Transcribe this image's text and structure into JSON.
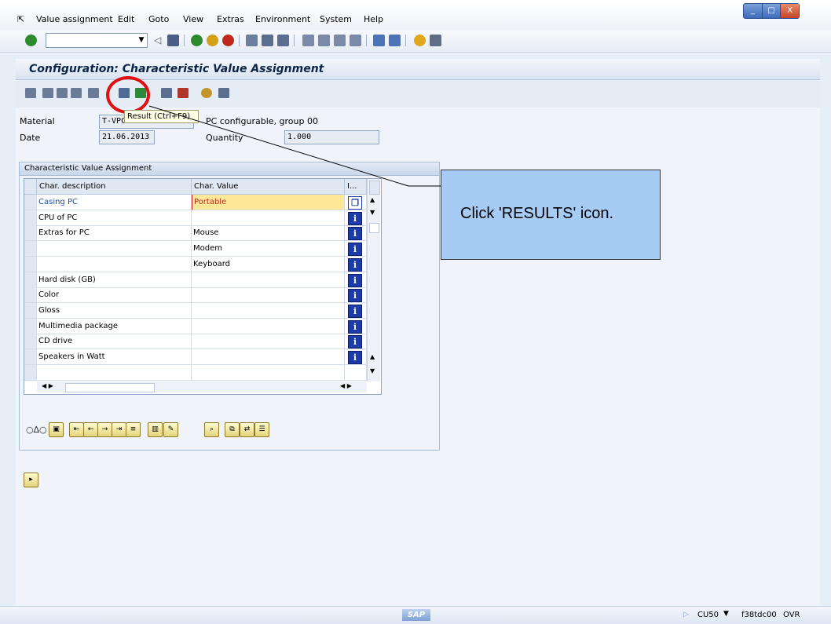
{
  "menubar": {
    "items": [
      "Value assignment",
      "Edit",
      "Goto",
      "View",
      "Extras",
      "Environment",
      "System",
      "Help"
    ]
  },
  "window_controls": [
    "_",
    "□",
    "X"
  ],
  "title": "Configuration: Characteristic Value Assignment",
  "header_fields": {
    "material_label": "Material",
    "material_value": "T-VPC",
    "material_desc": "PC configurable, group 00",
    "date_label": "Date",
    "date_value": "21.06.2013",
    "quantity_label": "Quantity",
    "quantity_value": "1.000"
  },
  "tooltip": "Result    (Ctrl+F9)",
  "group_title": "Characteristic Value Assignment",
  "table": {
    "columns": [
      "Char. description",
      "Char. Value",
      "I..."
    ],
    "rows": [
      {
        "desc": "Casing PC",
        "value": "Portable",
        "info": "copy"
      },
      {
        "desc": "CPU of PC",
        "value": "",
        "info": "i"
      },
      {
        "desc": "Extras for PC",
        "value": "Mouse",
        "info": "i"
      },
      {
        "desc": "",
        "value": "Modem",
        "info": "i"
      },
      {
        "desc": "",
        "value": "Keyboard",
        "info": "i"
      },
      {
        "desc": "Hard disk (GB)",
        "value": "",
        "info": "i"
      },
      {
        "desc": "Color",
        "value": "",
        "info": "i"
      },
      {
        "desc": "Gloss",
        "value": "",
        "info": "i"
      },
      {
        "desc": " Multimedia package",
        "value": "",
        "info": "i"
      },
      {
        "desc": "CD drive",
        "value": "",
        "info": "i"
      },
      {
        "desc": "Speakers in Watt",
        "value": "",
        "info": "i"
      },
      {
        "desc": "",
        "value": "",
        "info": ""
      }
    ]
  },
  "callout_text": "Click 'RESULTS' icon.",
  "status": {
    "sap_logo": "SAP",
    "transaction": "CU50",
    "server": "f38tdc00",
    "mode": "OVR"
  },
  "colors": {
    "highlight": "#e01010",
    "callout_bg": "#a6cbf5",
    "link_blue": "#1c4fa8",
    "value_red": "#c0281c"
  }
}
